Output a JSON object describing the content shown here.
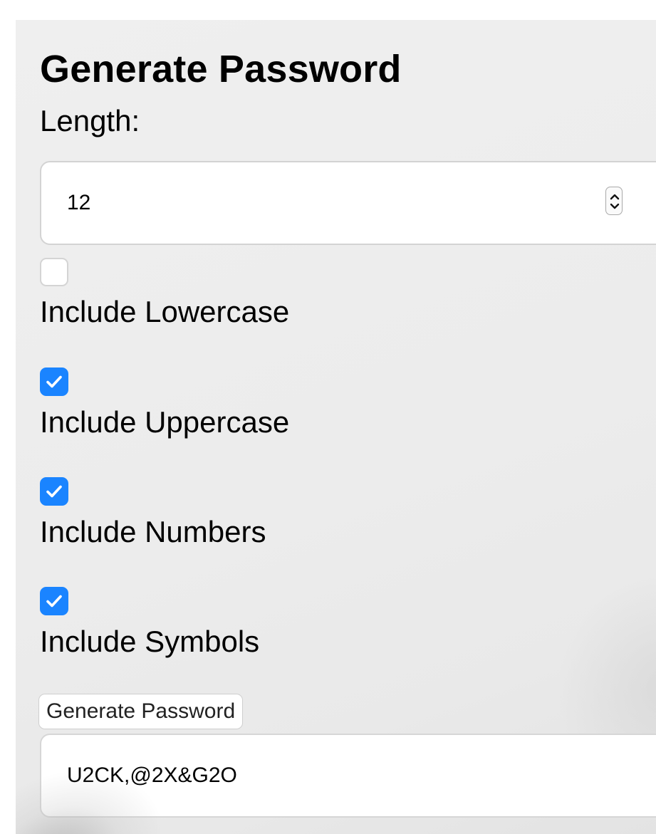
{
  "generator": {
    "title": "Generate Password",
    "length_label": "Length:",
    "length_value": "12",
    "options": [
      {
        "label": "Include Lowercase",
        "checked": false
      },
      {
        "label": "Include Uppercase",
        "checked": true
      },
      {
        "label": "Include Numbers",
        "checked": true
      },
      {
        "label": "Include Symbols",
        "checked": true
      }
    ],
    "button_label": "Generate Password",
    "output_value": "U2CK,@2X&G2O"
  },
  "colors": {
    "checkbox_checked": "#1a84ff",
    "panel_background": "#ececec"
  }
}
